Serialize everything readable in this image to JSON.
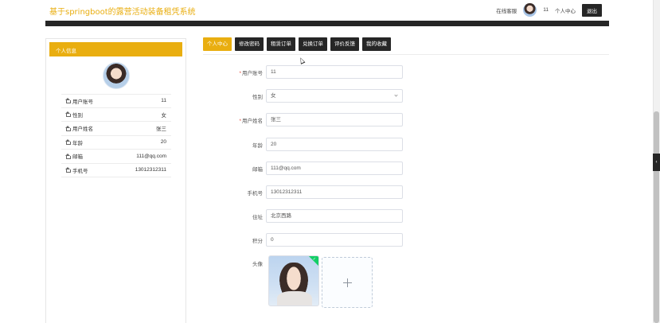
{
  "header": {
    "site_title": "基于springboot的露营活动装备租凭系统",
    "band_text": "",
    "online_label": "在线客服",
    "username": "11",
    "personal_center": "个人中心",
    "logout": "退出"
  },
  "profile": {
    "title": "个人信息",
    "rows": [
      {
        "label": "用户账号",
        "value": "11"
      },
      {
        "label": "性别",
        "value": "女"
      },
      {
        "label": "用户姓名",
        "value": "张三"
      },
      {
        "label": "年龄",
        "value": "20"
      },
      {
        "label": "邮箱",
        "value": "111@qq.com"
      },
      {
        "label": "手机号",
        "value": "13012312311"
      }
    ]
  },
  "tabs": [
    {
      "label": "个人中心",
      "active": true
    },
    {
      "label": "修改密码",
      "active": false
    },
    {
      "label": "租赁订单",
      "active": false
    },
    {
      "label": "兑换订单",
      "active": false
    },
    {
      "label": "评价反馈",
      "active": false
    },
    {
      "label": "我的收藏",
      "active": false
    }
  ],
  "form": {
    "account": {
      "label": "用户账号",
      "value": "11"
    },
    "gender": {
      "label": "性别",
      "value": "女"
    },
    "name": {
      "label": "用户姓名",
      "value": "张三"
    },
    "age": {
      "label": "年龄",
      "value": "20"
    },
    "email": {
      "label": "邮箱",
      "value": "111@qq.com"
    },
    "phone": {
      "label": "手机号",
      "value": "13012312311"
    },
    "address": {
      "label": "住址",
      "value": "北京西路"
    },
    "points": {
      "label": "积分",
      "value": "0"
    },
    "avatar_label": "头像"
  },
  "colors": {
    "accent": "#e9ae10",
    "dark": "#262626",
    "success": "#13ce66"
  }
}
